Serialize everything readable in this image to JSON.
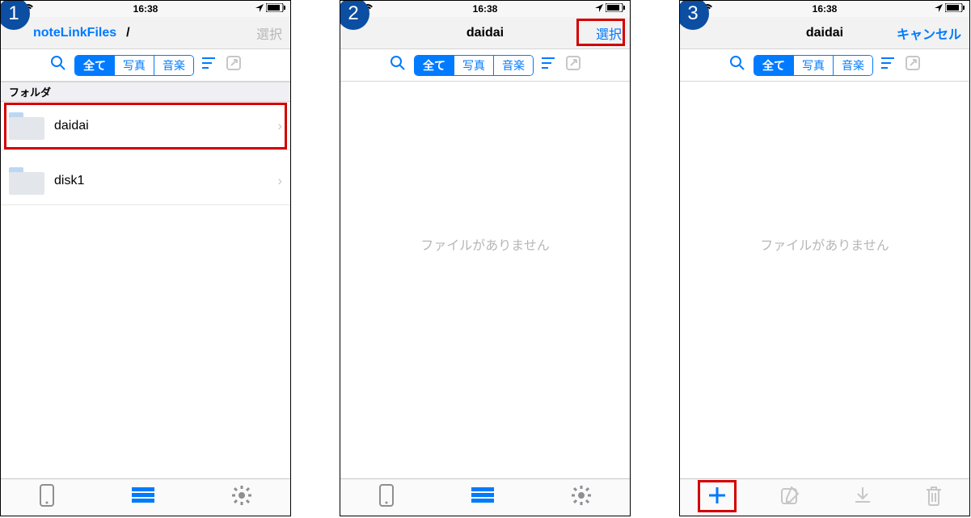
{
  "status": {
    "time": "16:38"
  },
  "badges": {
    "s1": "1",
    "s2": "2",
    "s3": "3"
  },
  "nav": {
    "back_label": "noteLinkFiles",
    "breadcrumb": "/",
    "select": "選択",
    "cancel": "キャンセル",
    "title_daidai": "daidai"
  },
  "segments": {
    "all": "全て",
    "photo": "写真",
    "music": "音楽"
  },
  "section": {
    "folder": "フォルダ"
  },
  "rows": {
    "r1": "daidai",
    "r2": "disk1"
  },
  "empty": "ファイルがありません"
}
